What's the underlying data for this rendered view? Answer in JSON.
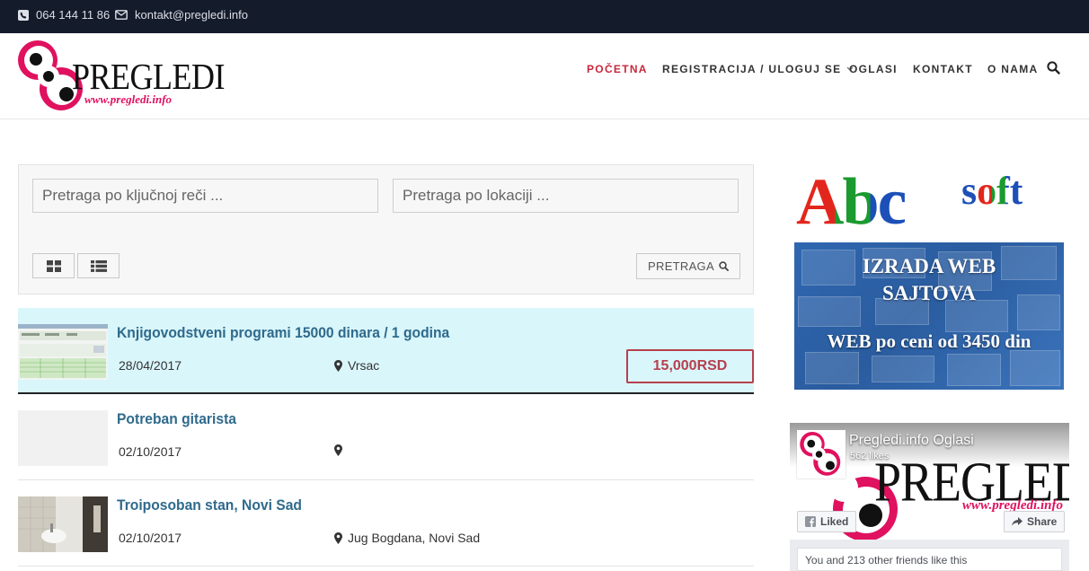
{
  "topbar": {
    "phone": "064 144 11 86",
    "email": "kontakt@pregledi.info",
    "icons": [
      "phone-icon",
      "envelope-icon"
    ]
  },
  "header": {
    "logo_text": "PREGLEDI",
    "logo_url": "www.pregledi.info",
    "nav": [
      {
        "label": "POČETNA",
        "active": true
      },
      {
        "label": "REGISTRACIJA / ULOGUJ SE",
        "has_dropdown": true
      },
      {
        "label": "OGLASI"
      },
      {
        "label": "KONTAKT"
      },
      {
        "label": "O NAMA"
      }
    ],
    "search_icon": "search-icon"
  },
  "search": {
    "keyword_placeholder": "Pretraga po ključnoj reči ...",
    "location_placeholder": "Pretraga po lokaciji ...",
    "button_label": "PRETRAGA",
    "view_icons": [
      "grid-view-icon",
      "list-view-icon"
    ]
  },
  "listings": [
    {
      "title": "Knjigovodstveni programi 15000 dinara / 1 godina",
      "date": "28/04/2017",
      "location": "Vrsac",
      "price": "15,000RSD",
      "featured": true
    },
    {
      "title": "Potreban gitarista",
      "date": "02/10/2017",
      "location": ""
    },
    {
      "title": "Troiposoban stan, Novi Sad",
      "date": "02/10/2017",
      "location": "Jug Bogdana, Novi Sad"
    }
  ],
  "ad": {
    "brand_abc": "Abc",
    "brand_soft": "soft",
    "line1": "IZRADA WEB",
    "line2": "SAJTOVA",
    "line3": "WEB po ceni od 3450 din",
    "colors": {
      "a": "#e3261d",
      "b": "#1a9a2f",
      "c": "#1c4fb8",
      "soft_s": "#1c4fb8",
      "soft_o": "#e3261d",
      "soft_f": "#1a9a2f",
      "soft_t": "#1c4fb8"
    }
  },
  "facebook": {
    "page_name": "Pregledi.info Oglasi",
    "likes": "562 likes",
    "liked_label": "Liked",
    "share_label": "Share",
    "friends_text": "You and 213 other friends like this",
    "cover_text": "PREGLEDI",
    "cover_url": "www.pregledi.info"
  },
  "colors": {
    "topbar_bg": "#141b2b",
    "nav_active": "#c8283c",
    "listing_title": "#2f6a8c",
    "price_border": "#b7404e",
    "featured_bg": "#d9f6fb",
    "logo_pink": "#e0115f"
  }
}
